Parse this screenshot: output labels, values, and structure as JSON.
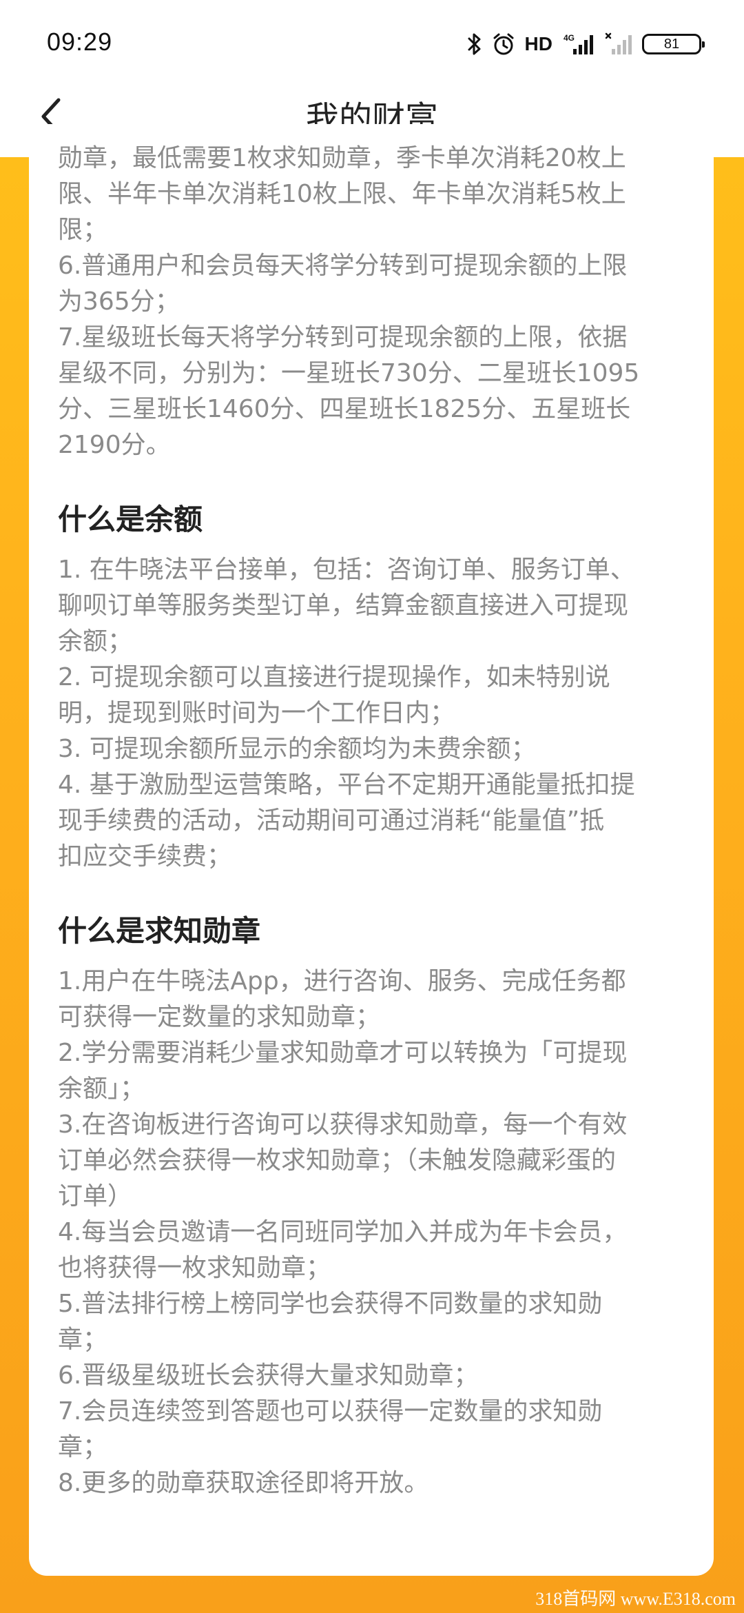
{
  "status_bar": {
    "time": "09:29",
    "network_label": "HD",
    "signal_label": "4G",
    "battery": "81"
  },
  "header": {
    "title": "我的财富"
  },
  "continued_section": {
    "lines": [
      "勋章，最低需要1枚求知勋章，季卡单次消耗20枚上",
      "限、半年卡单次消耗10枚上限、年卡单次消耗5枚上",
      "限；",
      "6.普通用户和会员每天将学分转到可提现余额的上限",
      "为365分；",
      "7.星级班长每天将学分转到可提现余额的上限，依据",
      "星级不同，分别为：一星班长730分、二星班长1095",
      "分、三星班长1460分、四星班长1825分、五星班长",
      "2190分。"
    ]
  },
  "balance_section": {
    "title": "什么是余额",
    "lines": [
      "1. 在牛晓法平台接单，包括：咨询订单、服务订单、",
      "聊呗订单等服务类型订单，结算金额直接进入可提现",
      "余额；",
      "2. 可提现余额可以直接进行提现操作，如未特别说",
      "明，提现到账时间为一个工作日内；",
      "3. 可提现余额所显示的余额均为未费余额；",
      "4. 基于激励型运营策略，平台不定期开通能量抵扣提",
      "现手续费的活动，活动期间可通过消耗“能量值”抵",
      "扣应交手续费；"
    ]
  },
  "badge_section": {
    "title": "什么是求知勋章",
    "lines": [
      "1.用户在牛晓法App，进行咨询、服务、完成任务都",
      "可获得一定数量的求知勋章；",
      "2.学分需要消耗少量求知勋章才可以转换为「可提现",
      "余额」；",
      "3.在咨询板进行咨询可以获得求知勋章，每一个有效",
      "订单必然会获得一枚求知勋章；（未触发隐藏彩蛋的",
      "订单）",
      "4.每当会员邀请一名同班同学加入并成为年卡会员，",
      "也将获得一枚求知勋章；",
      "5.普法排行榜上榜同学也会获得不同数量的求知勋",
      "章；",
      "6.晋级星级班长会获得大量求知勋章；",
      "7.会员连续签到答题也可以获得一定数量的求知勋",
      "章；",
      "8.更多的勋章获取途径即将开放。"
    ]
  },
  "watermark": "318首码网 www.E318.com",
  "colors": {
    "background_gradient_top": "#ffc21a",
    "background_gradient_bottom": "#f9a01a",
    "card": "#ffffff",
    "body_text": "#8a8a8a",
    "heading_text": "#222222"
  }
}
